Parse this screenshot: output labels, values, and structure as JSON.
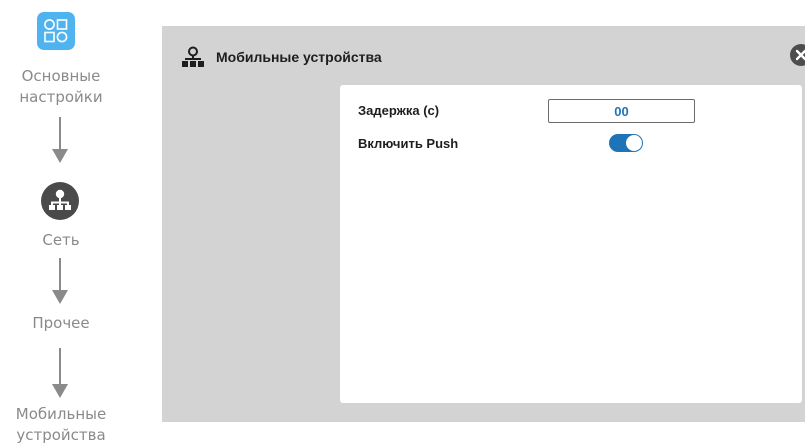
{
  "stepper": {
    "steps": [
      {
        "label_line1": "Основные",
        "label_line2": "настройки",
        "icon": "grid-settings-icon"
      },
      {
        "label": "Сеть",
        "icon": "network-icon"
      },
      {
        "label": "Прочее"
      },
      {
        "label_line1": "Мобильные",
        "label_line2": "устройства"
      }
    ]
  },
  "panel": {
    "title": "Мобильные устройства",
    "icon": "network-icon",
    "close_icon": "close-icon",
    "fields": {
      "delay": {
        "label": "Задержка (с)",
        "value": "00"
      },
      "push": {
        "label": "Включить Push",
        "enabled": true
      }
    }
  },
  "colors": {
    "accent": "#1f74b8",
    "icon_light_blue": "#4fb3f0",
    "panel_bg": "#d3d3d3",
    "step_text": "#8a8a8a"
  }
}
